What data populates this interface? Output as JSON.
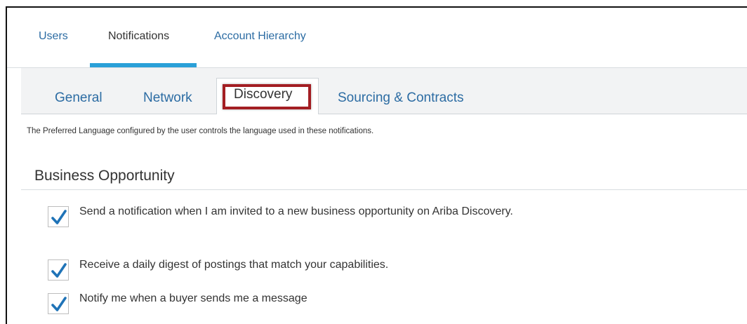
{
  "top_tabs": {
    "users": "Users",
    "notifications": "Notifications",
    "account_hierarchy": "Account Hierarchy"
  },
  "sub_tabs": {
    "general": "General",
    "network": "Network",
    "discovery": "Discovery",
    "sourcing_contracts": "Sourcing & Contracts"
  },
  "active_top_tab": "Notifications",
  "active_sub_tab": "Discovery",
  "info_text": "The Preferred Language configured by the user controls the language used in these notifications.",
  "section": {
    "title": "Business Opportunity",
    "options": [
      {
        "label": "Send a notification when I am invited to a new business opportunity on Ariba Discovery.",
        "checked": true
      },
      {
        "label": "Receive a daily digest of postings that match your capabilities.",
        "checked": true
      },
      {
        "label": "Notify me when a buyer sends me a message",
        "checked": true
      }
    ]
  },
  "colors": {
    "link": "#2c6ca3",
    "active_indicator": "#2aa0d8",
    "highlight_border": "#a31e23",
    "checkmark": "#1f73b7"
  },
  "icons": {
    "checkbox_checked": "checkmark-icon"
  }
}
